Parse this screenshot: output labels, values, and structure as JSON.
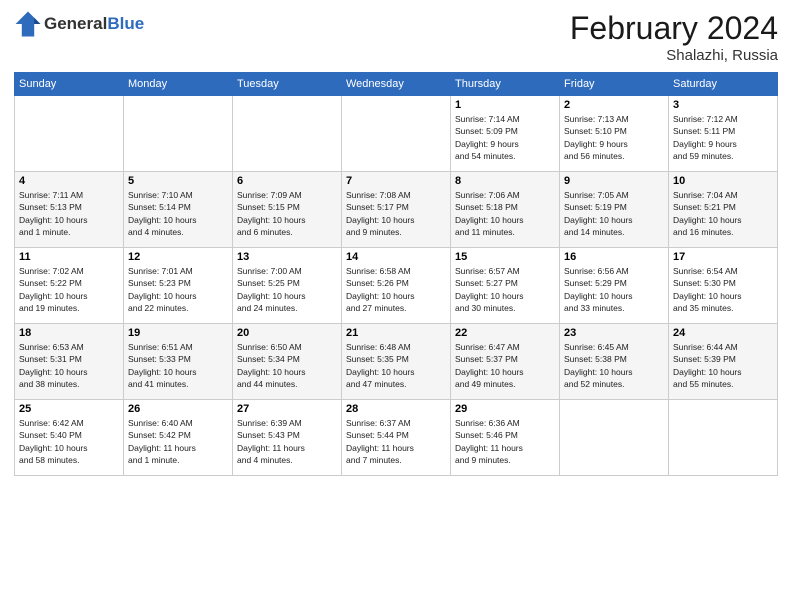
{
  "header": {
    "logo_line1": "General",
    "logo_line2": "Blue",
    "month_title": "February 2024",
    "location": "Shalazhi, Russia"
  },
  "weekdays": [
    "Sunday",
    "Monday",
    "Tuesday",
    "Wednesday",
    "Thursday",
    "Friday",
    "Saturday"
  ],
  "weeks": [
    [
      {
        "day": "",
        "detail": ""
      },
      {
        "day": "",
        "detail": ""
      },
      {
        "day": "",
        "detail": ""
      },
      {
        "day": "",
        "detail": ""
      },
      {
        "day": "1",
        "detail": "Sunrise: 7:14 AM\nSunset: 5:09 PM\nDaylight: 9 hours\nand 54 minutes."
      },
      {
        "day": "2",
        "detail": "Sunrise: 7:13 AM\nSunset: 5:10 PM\nDaylight: 9 hours\nand 56 minutes."
      },
      {
        "day": "3",
        "detail": "Sunrise: 7:12 AM\nSunset: 5:11 PM\nDaylight: 9 hours\nand 59 minutes."
      }
    ],
    [
      {
        "day": "4",
        "detail": "Sunrise: 7:11 AM\nSunset: 5:13 PM\nDaylight: 10 hours\nand 1 minute."
      },
      {
        "day": "5",
        "detail": "Sunrise: 7:10 AM\nSunset: 5:14 PM\nDaylight: 10 hours\nand 4 minutes."
      },
      {
        "day": "6",
        "detail": "Sunrise: 7:09 AM\nSunset: 5:15 PM\nDaylight: 10 hours\nand 6 minutes."
      },
      {
        "day": "7",
        "detail": "Sunrise: 7:08 AM\nSunset: 5:17 PM\nDaylight: 10 hours\nand 9 minutes."
      },
      {
        "day": "8",
        "detail": "Sunrise: 7:06 AM\nSunset: 5:18 PM\nDaylight: 10 hours\nand 11 minutes."
      },
      {
        "day": "9",
        "detail": "Sunrise: 7:05 AM\nSunset: 5:19 PM\nDaylight: 10 hours\nand 14 minutes."
      },
      {
        "day": "10",
        "detail": "Sunrise: 7:04 AM\nSunset: 5:21 PM\nDaylight: 10 hours\nand 16 minutes."
      }
    ],
    [
      {
        "day": "11",
        "detail": "Sunrise: 7:02 AM\nSunset: 5:22 PM\nDaylight: 10 hours\nand 19 minutes."
      },
      {
        "day": "12",
        "detail": "Sunrise: 7:01 AM\nSunset: 5:23 PM\nDaylight: 10 hours\nand 22 minutes."
      },
      {
        "day": "13",
        "detail": "Sunrise: 7:00 AM\nSunset: 5:25 PM\nDaylight: 10 hours\nand 24 minutes."
      },
      {
        "day": "14",
        "detail": "Sunrise: 6:58 AM\nSunset: 5:26 PM\nDaylight: 10 hours\nand 27 minutes."
      },
      {
        "day": "15",
        "detail": "Sunrise: 6:57 AM\nSunset: 5:27 PM\nDaylight: 10 hours\nand 30 minutes."
      },
      {
        "day": "16",
        "detail": "Sunrise: 6:56 AM\nSunset: 5:29 PM\nDaylight: 10 hours\nand 33 minutes."
      },
      {
        "day": "17",
        "detail": "Sunrise: 6:54 AM\nSunset: 5:30 PM\nDaylight: 10 hours\nand 35 minutes."
      }
    ],
    [
      {
        "day": "18",
        "detail": "Sunrise: 6:53 AM\nSunset: 5:31 PM\nDaylight: 10 hours\nand 38 minutes."
      },
      {
        "day": "19",
        "detail": "Sunrise: 6:51 AM\nSunset: 5:33 PM\nDaylight: 10 hours\nand 41 minutes."
      },
      {
        "day": "20",
        "detail": "Sunrise: 6:50 AM\nSunset: 5:34 PM\nDaylight: 10 hours\nand 44 minutes."
      },
      {
        "day": "21",
        "detail": "Sunrise: 6:48 AM\nSunset: 5:35 PM\nDaylight: 10 hours\nand 47 minutes."
      },
      {
        "day": "22",
        "detail": "Sunrise: 6:47 AM\nSunset: 5:37 PM\nDaylight: 10 hours\nand 49 minutes."
      },
      {
        "day": "23",
        "detail": "Sunrise: 6:45 AM\nSunset: 5:38 PM\nDaylight: 10 hours\nand 52 minutes."
      },
      {
        "day": "24",
        "detail": "Sunrise: 6:44 AM\nSunset: 5:39 PM\nDaylight: 10 hours\nand 55 minutes."
      }
    ],
    [
      {
        "day": "25",
        "detail": "Sunrise: 6:42 AM\nSunset: 5:40 PM\nDaylight: 10 hours\nand 58 minutes."
      },
      {
        "day": "26",
        "detail": "Sunrise: 6:40 AM\nSunset: 5:42 PM\nDaylight: 11 hours\nand 1 minute."
      },
      {
        "day": "27",
        "detail": "Sunrise: 6:39 AM\nSunset: 5:43 PM\nDaylight: 11 hours\nand 4 minutes."
      },
      {
        "day": "28",
        "detail": "Sunrise: 6:37 AM\nSunset: 5:44 PM\nDaylight: 11 hours\nand 7 minutes."
      },
      {
        "day": "29",
        "detail": "Sunrise: 6:36 AM\nSunset: 5:46 PM\nDaylight: 11 hours\nand 9 minutes."
      },
      {
        "day": "",
        "detail": ""
      },
      {
        "day": "",
        "detail": ""
      }
    ]
  ]
}
